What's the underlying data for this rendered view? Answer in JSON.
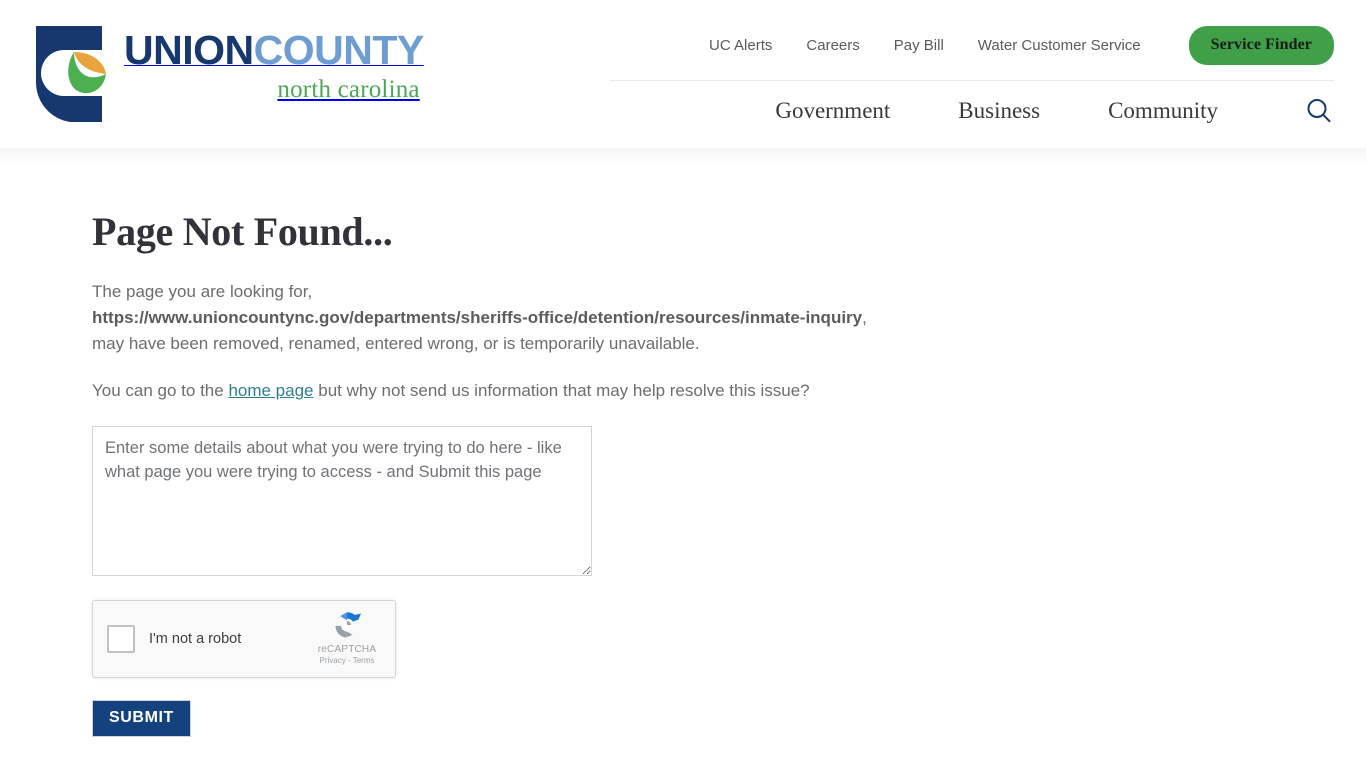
{
  "brand": {
    "logo_icon": "union-county-shield-leaf-logo",
    "word_primary": "UNION",
    "word_secondary": "COUNTY",
    "tagline": "north carolina",
    "colors": {
      "navy": "#17386f",
      "light_blue": "#6e9dd2",
      "green": "#4aa855",
      "leaf_orange": "#e8a33d",
      "leaf_green": "#4caf50"
    }
  },
  "header": {
    "utility_links": [
      {
        "label": "UC Alerts"
      },
      {
        "label": "Careers"
      },
      {
        "label": "Pay Bill"
      },
      {
        "label": "Water Customer Service"
      }
    ],
    "service_finder_label": "Service Finder",
    "service_finder_color": "#3fa048",
    "nav_links": [
      {
        "label": "Government"
      },
      {
        "label": "Business"
      },
      {
        "label": "Community"
      }
    ],
    "search_icon": "search-icon",
    "search_icon_color": "#17386f"
  },
  "main": {
    "title": "Page Not Found...",
    "intro_lead": "The page you are looking for,",
    "missing_url": "https://www.unioncountync.gov/departments/sheriffs-office/detention/resources/inmate-inquiry",
    "intro_tail": ",",
    "intro_rest": "may have been removed, renamed, entered wrong, or is temporarily unavailable.",
    "help_prefix": "You can go to the ",
    "help_link_label": "home page",
    "help_link_color": "#2e7e91",
    "help_suffix": " but why not send us information that may help resolve this issue?",
    "details_placeholder": "Enter some details about what you were trying to do here - like what page you were trying to access - and Submit this page",
    "details_value": "",
    "submit_label": "SUBMIT",
    "submit_color": "#14427e"
  },
  "recaptcha": {
    "checkbox_label": "I'm not a robot",
    "brand_name": "reCAPTCHA",
    "legal_text": "Privacy - Terms",
    "logo_icon": "recaptcha-logo"
  }
}
